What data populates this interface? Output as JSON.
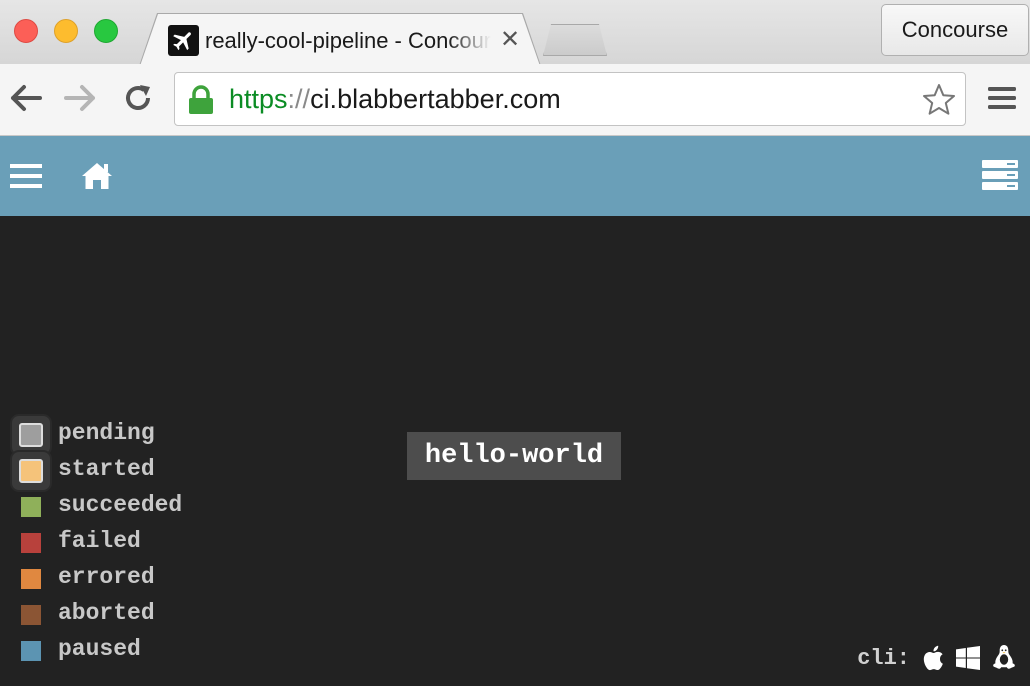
{
  "browser": {
    "tab_title": "really-cool-pipeline - Concourse",
    "tab_close": "✕",
    "profile_label": "Concourse",
    "url_scheme": "https",
    "url_separator": "://",
    "url_host": "ci.blabbertabber.com"
  },
  "topbar": {
    "background": "#6a9fb8",
    "icons": [
      "hamburger-menu-icon",
      "home-icon",
      "server-icon"
    ]
  },
  "pipeline": {
    "jobs": [
      {
        "name": "hello-world"
      }
    ]
  },
  "legend": [
    {
      "label": "pending",
      "color": "#9e9e9e",
      "highlight": true
    },
    {
      "label": "started",
      "color": "#f5c37a",
      "highlight": true
    },
    {
      "label": "succeeded",
      "color": "#8fb05a"
    },
    {
      "label": "failed",
      "color": "#b8413c"
    },
    {
      "label": "errored",
      "color": "#e08840"
    },
    {
      "label": "aborted",
      "color": "#8b5534"
    },
    {
      "label": "paused",
      "color": "#5c94b2"
    }
  ],
  "cli": {
    "label": "cli:",
    "platforms": [
      "apple-icon",
      "windows-icon",
      "linux-icon"
    ]
  }
}
